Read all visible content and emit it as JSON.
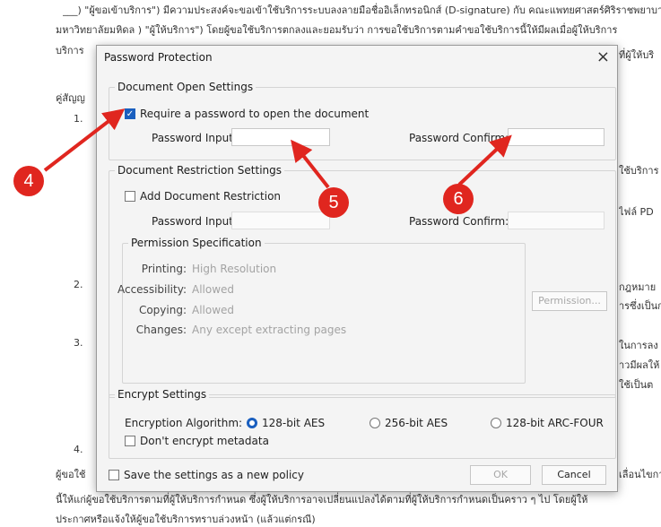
{
  "background_doc": {
    "lines": [
      "___)  \"ผู้ขอเข้าบริการ\") มีความประสงค์จะขอเข้าใช้บริการระบบลงลายมือชื่ออิเล็กทรอนิกส์ (D-signature) กับ คณะแพทยศาสตร์ศิริราชพยาบาล",
      "มหาวิทยาลัยมหิดล ) \"ผู้ให้บริการ\") โดยผู้ขอใช้บริการตกลงและยอมรับว่า การขอใช้บริการตามคำขอใช้บริการนี้ให้มีผลเมื่อผู้ให้บริการ",
      "บริการ",
      "คู่สัญญ",
      "1.",
      "2.",
      "3.",
      "4.",
      "ผู้ขอใช้",
      "นี้ให้แก่ผู้ขอใช้บริการตามที่ผู้ให้บริการกำหนด ซึ่งผู้ให้บริการอาจเปลี่ยนแปลงได้ตามที่ผู้ให้บริการกำหนดเป็นคราว ๆ ไป โดยผู้ให้",
      "ประกาศหรือแจ้งให้ผู้ขอใช้บริการทราบล่วงหน้า (แล้วแต่กรณี)"
    ],
    "right_fragments": [
      "ที่ผู้ให้บริ",
      "ใช้บริการ",
      "ไฟล์ PD",
      "กฎหมาย",
      "ารซึ่งเป็นก",
      "ในการลง",
      "าวมีผลให้",
      "ใช้เป็นต",
      "เลื่อนไขกา"
    ]
  },
  "dialog": {
    "title": "Password Protection",
    "close_glyph": "×",
    "open_settings": {
      "legend": "Document Open Settings",
      "require_label": "Require a password to open the document",
      "require_checked": true,
      "password_input_label": "Password Input:",
      "password_input_value": "",
      "password_confirm_label": "Password Confirm:",
      "password_confirm_value": ""
    },
    "restriction_settings": {
      "legend": "Document Restriction Settings",
      "add_label": "Add Document Restriction",
      "add_checked": false,
      "password_input_label": "Password Input:",
      "password_confirm_label": "Password Confirm:"
    },
    "permission": {
      "legend": "Permission Specification",
      "rows": [
        {
          "label": "Printing:",
          "value": "High Resolution"
        },
        {
          "label": "Accessibility:",
          "value": "Allowed"
        },
        {
          "label": "Copying:",
          "value": "Allowed"
        },
        {
          "label": "Changes:",
          "value": "Any except extracting pages"
        }
      ],
      "button_label": "Permission..."
    },
    "encrypt": {
      "legend": "Encrypt Settings",
      "algorithm_label": "Encryption Algorithm:",
      "options": [
        "128-bit AES",
        "256-bit AES",
        "128-bit ARC-FOUR"
      ],
      "selected": "128-bit AES",
      "dont_encrypt_label": "Don't encrypt metadata"
    },
    "save_policy_label": "Save the settings as a new policy",
    "ok_label": "OK",
    "cancel_label": "Cancel"
  },
  "annotations": {
    "markers": [
      "4",
      "5",
      "6"
    ],
    "marker_color": "#e0261f"
  }
}
